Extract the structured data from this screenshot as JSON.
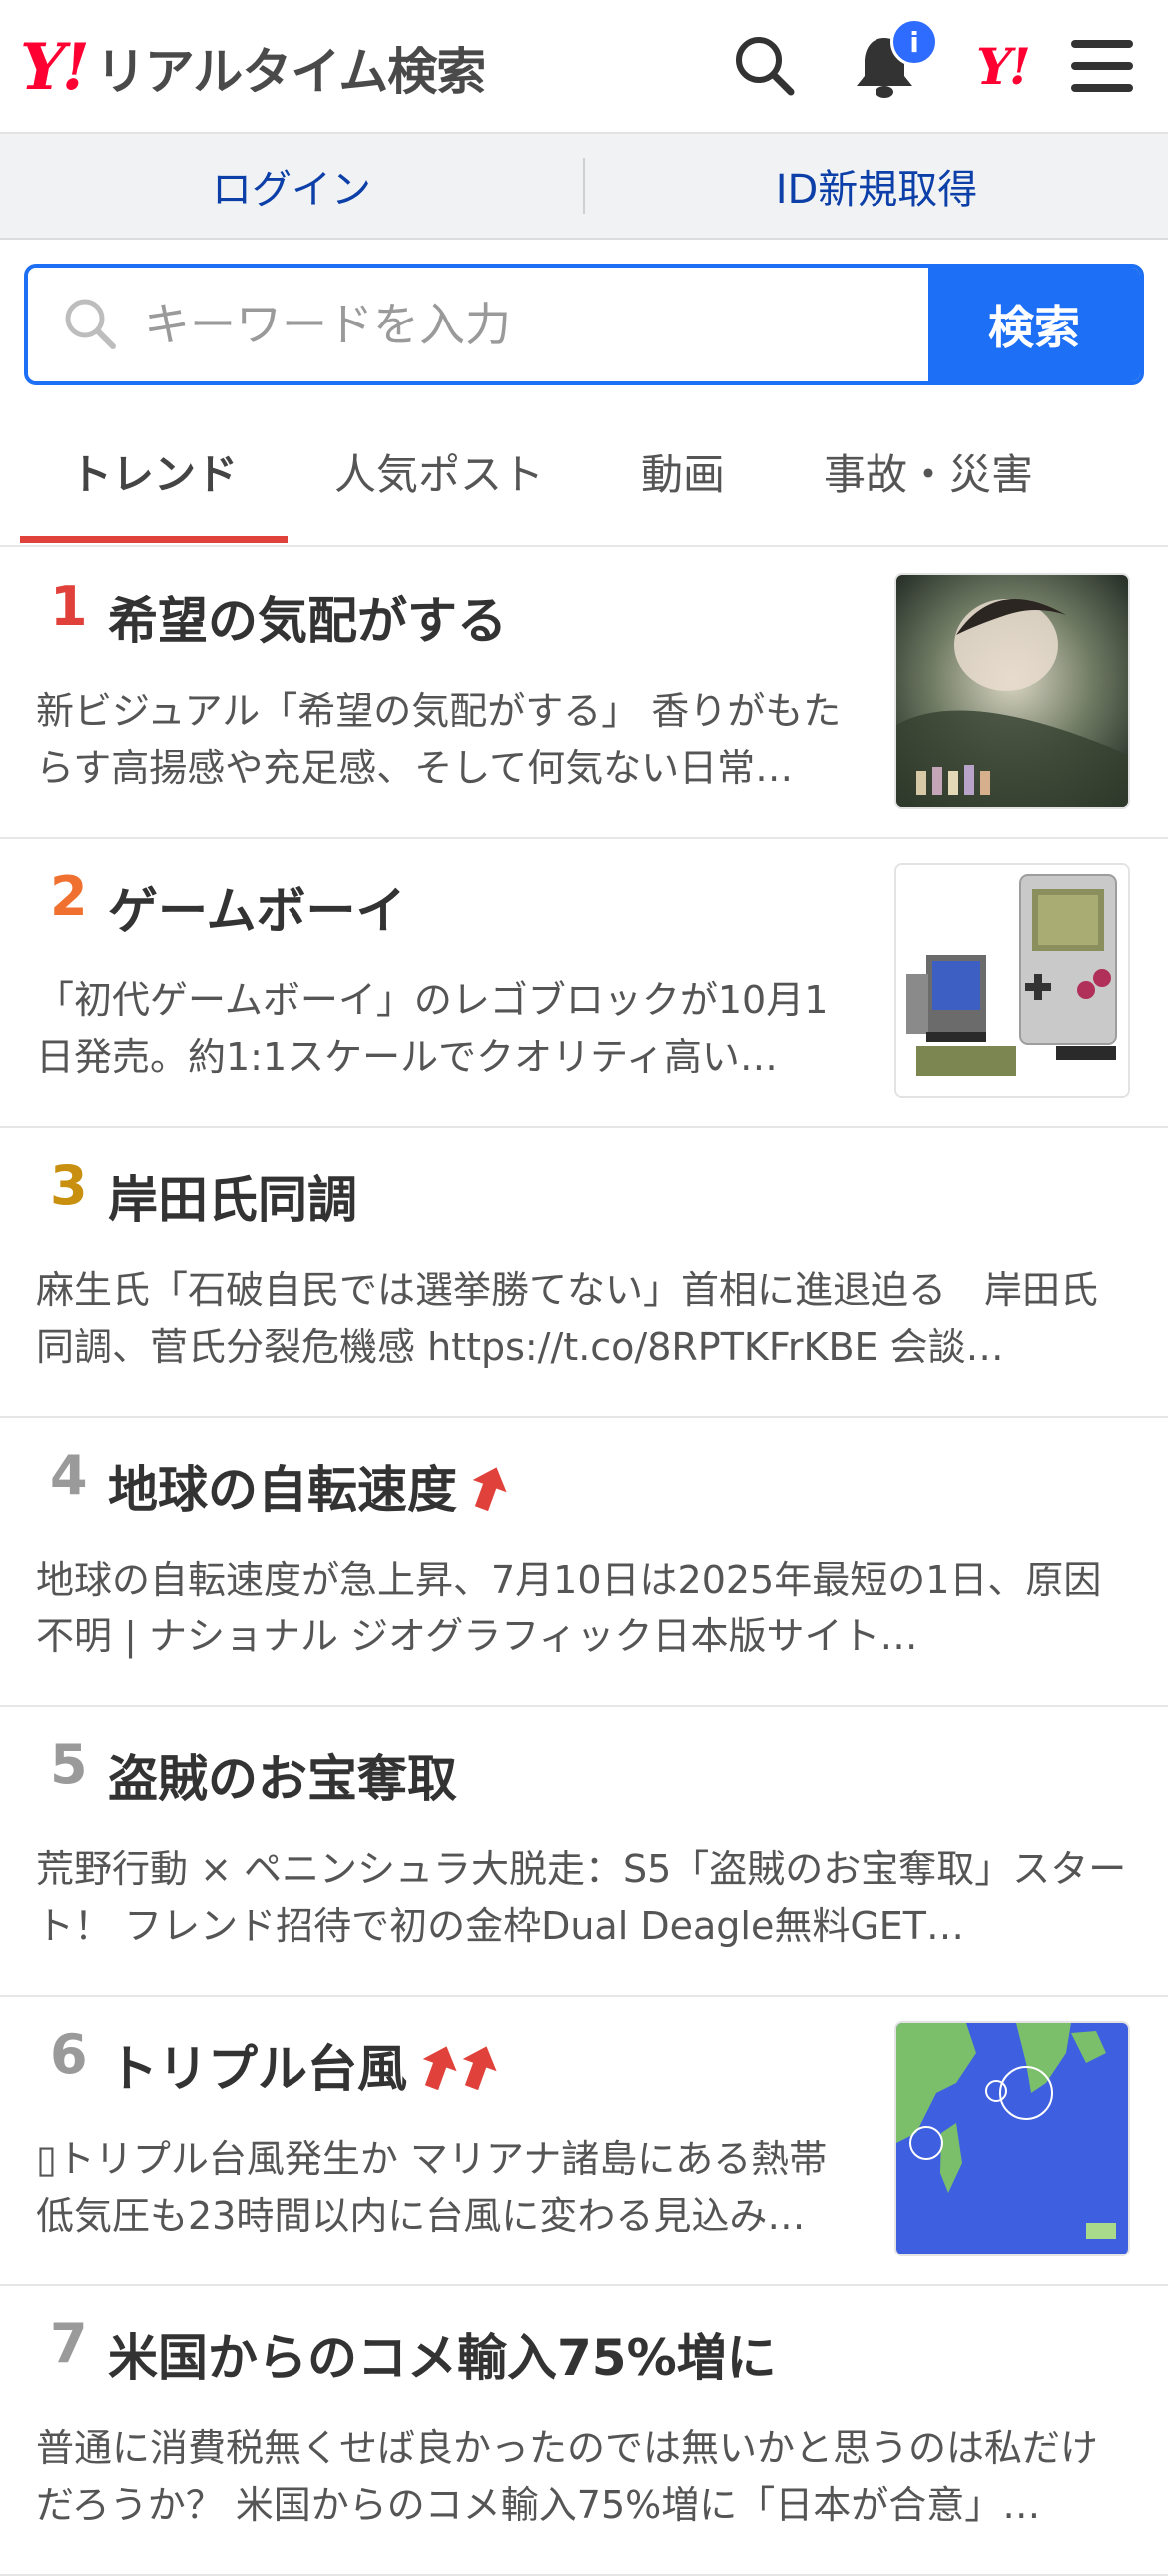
{
  "header": {
    "logo_mark": "Y!",
    "logo_text": "リアルタイム検索",
    "notification_badge": "i",
    "yj_mark": "Y!"
  },
  "auth": {
    "login": "ログイン",
    "signup": "ID新規取得"
  },
  "search": {
    "placeholder": "キーワードを入力",
    "button": "検索"
  },
  "tabs": [
    {
      "label": "トレンド",
      "active": true
    },
    {
      "label": "人気ポスト"
    },
    {
      "label": "動画"
    },
    {
      "label": "事故・災害"
    }
  ],
  "colors": {
    "accent_blue": "#1d6ff5",
    "brand_red": "#ff0033",
    "rank1": "#e0413a",
    "rank2": "#f07030",
    "rank3": "#c8900e",
    "rank_other": "#9a9a9a"
  },
  "trends": [
    {
      "rank": "1",
      "title": "希望の気配がする",
      "description": "新ビジュアル「希望の気配がする」 香りがもたらす高揚感や充足感、そして何気ない日常…",
      "thumbnail": "perfume-visual"
    },
    {
      "rank": "2",
      "title": "ゲームボーイ",
      "description": "「初代ゲームボーイ」のレゴブロックが10月1日発売。約1:1スケールでクオリティ高い…",
      "thumbnail": "lego-gameboy"
    },
    {
      "rank": "3",
      "title": "岸田氏同調",
      "description": "麻生氏「石破自民では選挙勝てない」首相に進退迫る　岸田氏同調、菅氏分裂危機感 https://t.co/8RPTKFrKBE 会談…"
    },
    {
      "rank": "4",
      "title": "地球の自転速度",
      "rising": 1,
      "description": "地球の自転速度が急上昇、7月10日は2025年最短の1日、原因不明 | ナショナル ジオグラフィック日本版サイト…"
    },
    {
      "rank": "5",
      "title": "盗賊のお宝奪取",
      "description": "荒野行動 × ペニンシュラ大脱走：S5「盗賊のお宝奪取」スタート！ フレンド招待で初の金枠Dual Deagle無料GET…"
    },
    {
      "rank": "6",
      "title": "トリプル台風",
      "rising": 2,
      "description": "▯トリプル台風発生か マリアナ諸島にある熱帯低気圧も23時間以内に台風に変わる見込み…",
      "thumbnail": "typhoon-map"
    },
    {
      "rank": "7",
      "title": "米国からのコメ輸入75%増に",
      "description": "普通に消費税無くせば良かったのでは無いかと思うのは私だけだろうか？ 米国からのコメ輸入75%増に「日本が合意」…"
    }
  ]
}
